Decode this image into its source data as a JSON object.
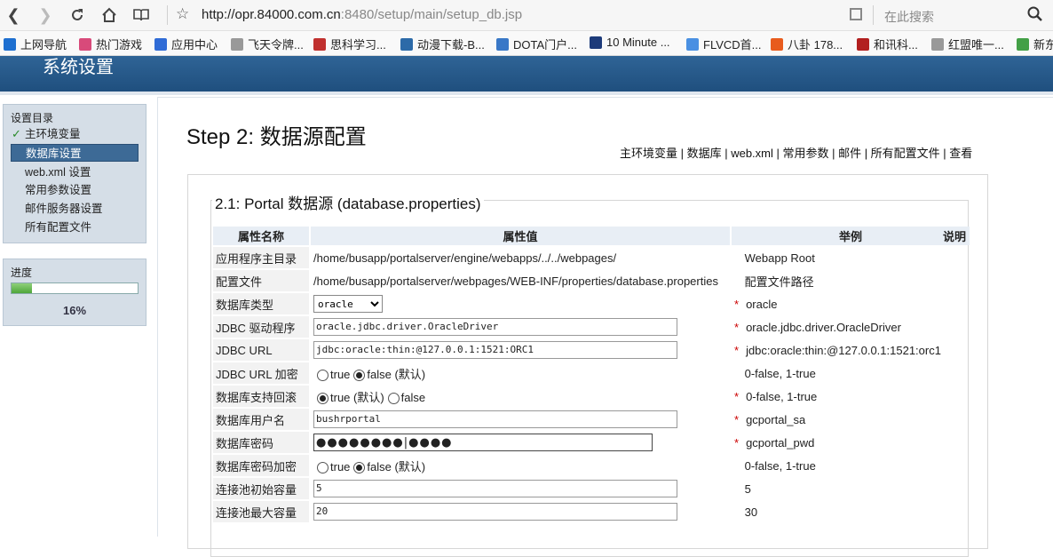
{
  "browser": {
    "url_host": "http://opr.84000.com.cn",
    "url_path": ":8480/setup/main/setup_db.jsp",
    "search_placeholder": "在此搜索",
    "bookmarks": [
      {
        "label": "上网导航",
        "color": "#1e6fd0"
      },
      {
        "label": "热门游戏",
        "color": "#d84a7a"
      },
      {
        "label": "应用中心",
        "color": "#2f6bd6"
      },
      {
        "label": "飞天令牌...",
        "color": "#999999"
      },
      {
        "label": "思科学习...",
        "color": "#c0302e"
      },
      {
        "label": "动漫下载-B...",
        "color": "#2c6aa8"
      },
      {
        "label": "DOTA门户...",
        "color": "#3978c7"
      },
      {
        "label": "10 Minute ...",
        "color": "#1d3b7a"
      },
      {
        "label": "FLVCD首...",
        "color": "#4a90e2"
      },
      {
        "label": "八卦 178...",
        "color": "#e85b1d"
      },
      {
        "label": "和讯科...",
        "color": "#b21f1f"
      },
      {
        "label": "红盟唯一...",
        "color": "#999999"
      },
      {
        "label": "新东",
        "color": "#43a047"
      }
    ]
  },
  "app": {
    "title": "系统设置"
  },
  "sidebar": {
    "menu_title": "设置目录",
    "items": [
      {
        "label": "主环境变量",
        "done": true
      },
      {
        "label": "数据库设置",
        "active": true
      },
      {
        "label": "web.xml 设置"
      },
      {
        "label": "常用参数设置"
      },
      {
        "label": "邮件服务器设置"
      },
      {
        "label": "所有配置文件"
      }
    ],
    "progress_title": "进度",
    "progress_value": 0.16,
    "progress_text": "16%"
  },
  "page": {
    "title": "Step 2: 数据源配置",
    "links": "主环境变量  | 数据库 | web.xml | 常用参数 | 邮件 | 所有配置文件  | 查看",
    "section_title": "2.1: Portal 数据源 (database.properties)"
  },
  "table": {
    "headers": [
      "属性名称",
      "属性值",
      "举例",
      "说明"
    ],
    "rows": [
      {
        "label": "应用程序主目录",
        "type": "text",
        "value": "/home/busapp/portalserver/engine/webapps/../../webpages/",
        "example": "Webapp Root"
      },
      {
        "label": "配置文件",
        "type": "text",
        "value": "/home/busapp/portalserver/webpages/WEB-INF/properties/database.properties",
        "example": "配置文件路径"
      },
      {
        "label": "数据库类型",
        "type": "select",
        "value": "oracle",
        "required": true,
        "example": "oracle"
      },
      {
        "label": "JDBC 驱动程序",
        "type": "input",
        "value": "oracle.jdbc.driver.OracleDriver",
        "required": true,
        "example": "oracle.jdbc.driver.OracleDriver"
      },
      {
        "label": "JDBC URL",
        "type": "input",
        "value": "jdbc:oracle:thin:@127.0.0.1:1521:ORC1",
        "required": true,
        "example": "jdbc:oracle:thin:@127.0.0.1:1521:orc1"
      },
      {
        "label": "JDBC URL 加密",
        "type": "radio",
        "opt1": "true",
        "opt2": "false (默认)",
        "selected": 2,
        "example": "0-false, 1-true"
      },
      {
        "label": "数据库支持回滚",
        "type": "radio",
        "opt1": "true (默认)",
        "opt2": "false",
        "selected": 1,
        "required": true,
        "example": "0-false, 1-true"
      },
      {
        "label": "数据库用户名",
        "type": "input",
        "value": "bushrportal",
        "required": true,
        "example": "gcportal_sa"
      },
      {
        "label": "数据库密码",
        "type": "password",
        "value": "●●●●●●●●|●●●●",
        "required": true,
        "example": "gcportal_pwd"
      },
      {
        "label": "数据库密码加密",
        "type": "radio",
        "opt1": "true",
        "opt2": "false (默认)",
        "selected": 2,
        "example": "0-false, 1-true"
      },
      {
        "label": "连接池初始容量",
        "type": "input",
        "value": "5",
        "example": "5"
      },
      {
        "label": "连接池最大容量",
        "type": "input",
        "value": "20",
        "example": "30"
      }
    ]
  }
}
